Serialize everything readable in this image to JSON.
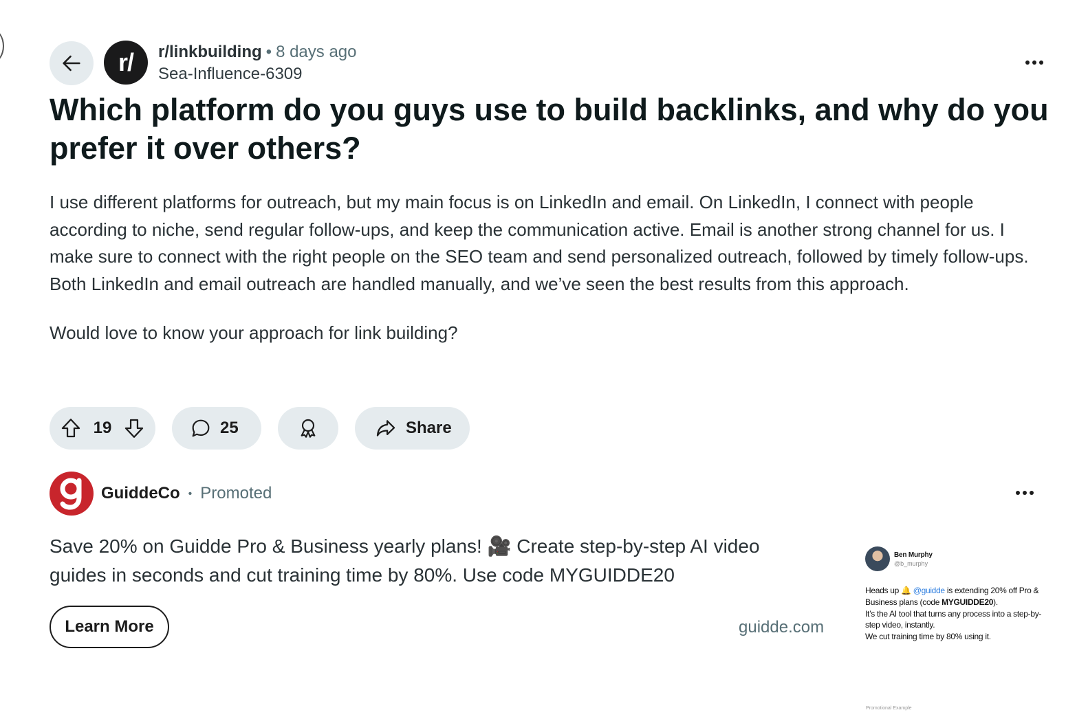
{
  "post": {
    "subreddit": "r/linkbuilding",
    "separator": "•",
    "time": "8 days ago",
    "author": "Sea-Influence-6309",
    "avatar_text": "r/",
    "title": "Which platform do you guys use to build backlinks, and why do you prefer it over others?",
    "body": [
      "I use different platforms for outreach, but my main focus is on LinkedIn and email. On LinkedIn, I connect with people according  to niche, send regular follow-ups, and keep the communication active. Email is another strong channel for us. I make sure to connect with the right people on the SEO team and send personalized outreach, followed by timely follow-ups. Both LinkedIn and email outreach are handled manually, and we’ve seen the best results from this approach.",
      "Would love to know your approach for link building?"
    ],
    "votes": "19",
    "comments": "25",
    "share_label": "Share"
  },
  "ad": {
    "advertiser": "GuiddeCo",
    "separator": "•",
    "promoted_label": "Promoted",
    "text": "Save 20% on Guidde Pro & Business yearly plans! 🎥 Create step-by-step AI video guides in seconds and cut training time by 80%. Use code MYGUIDDE20",
    "cta_label": "Learn More",
    "domain": "guidde.com",
    "tweet": {
      "name": "Ben Murphy",
      "handle": "@b_murphy",
      "line1_pre": "Heads up 🔔 ",
      "mention": "@guidde",
      "line1_post": " is extending 20% off Pro & Business plans (code ",
      "code": "MYGUIDDE20",
      "line1_end": ").",
      "line2": "It’s the AI tool that turns any process into a step-by-step video, instantly.",
      "line3": "We cut training time by 80% using it.",
      "footer": "Promotional Example"
    }
  },
  "colors": {
    "pill_bg": "#e5ebee",
    "meta_gray": "#576f76",
    "ad_logo_red": "#c8252c",
    "mention_blue": "#2f7fe0"
  },
  "icons": [
    "arrow-left-icon",
    "more-horizontal-icon",
    "upvote-icon",
    "downvote-icon",
    "comment-icon",
    "award-icon",
    "share-icon"
  ]
}
